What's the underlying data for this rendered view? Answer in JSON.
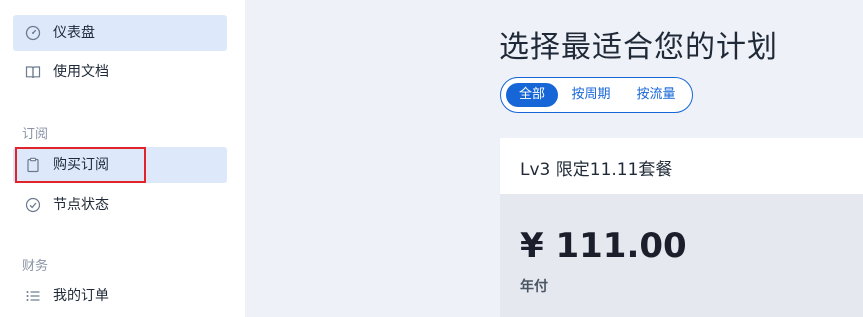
{
  "sidebar": {
    "items": [
      {
        "label": "仪表盘",
        "icon": "dashboard-icon"
      },
      {
        "label": "使用文档",
        "icon": "book-icon"
      }
    ],
    "sections": [
      {
        "title": "订阅",
        "items": [
          {
            "label": "购买订阅",
            "icon": "clipboard-icon"
          },
          {
            "label": "节点状态",
            "icon": "check-circle-icon"
          }
        ]
      },
      {
        "title": "财务",
        "items": [
          {
            "label": "我的订单",
            "icon": "list-icon"
          }
        ]
      }
    ]
  },
  "main": {
    "title": "选择最适合您的计划",
    "filters": [
      "全部",
      "按周期",
      "按流量"
    ],
    "selected_filter": "全部",
    "plan": {
      "name": "Lv3 限定11.11套餐",
      "price": "¥ 111.00",
      "period": "年付"
    }
  },
  "colors": {
    "accent": "#1666d8",
    "highlight": "#e0242a",
    "active_bg": "#dde9fb"
  }
}
